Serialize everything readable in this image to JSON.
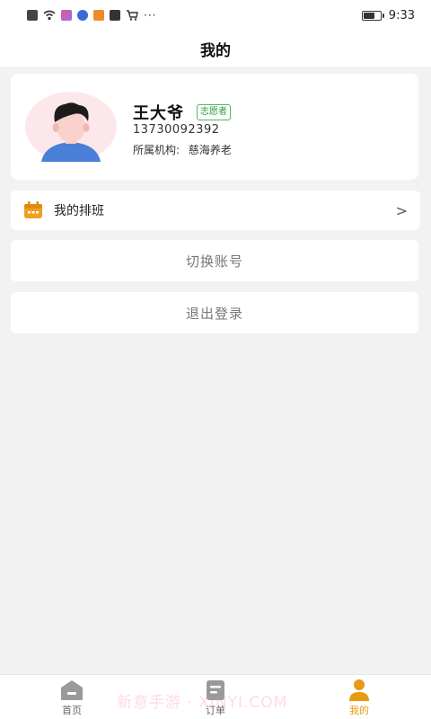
{
  "status_bar": {
    "time": "9:33",
    "dots": "···",
    "battery_level": 0.6,
    "icons": [
      "alert-icon",
      "wifi-icon",
      "app-icon",
      "app-icon",
      "play-icon",
      "play-icon",
      "cart-icon"
    ]
  },
  "header": {
    "title": "我的"
  },
  "profile": {
    "name": "王大爷",
    "badge": "志愿者",
    "phone": "13730092392",
    "org_label": "所属机构:",
    "org_value": "慈海养老"
  },
  "menu": {
    "schedule_label": "我的排班",
    "chevron": ">"
  },
  "actions": {
    "switch_account": "切换账号",
    "logout": "退出登录"
  },
  "tabs": [
    {
      "label": "首页",
      "icon": "home-icon",
      "active": false
    },
    {
      "label": "订单",
      "icon": "order-icon",
      "active": false
    },
    {
      "label": "我的",
      "icon": "person-icon",
      "active": true
    }
  ],
  "watermark": "新意手游 · XINYI.COM",
  "colors": {
    "accent": "#e89a10",
    "badge_green": "#4cb85c",
    "background": "#f2f2f2"
  }
}
